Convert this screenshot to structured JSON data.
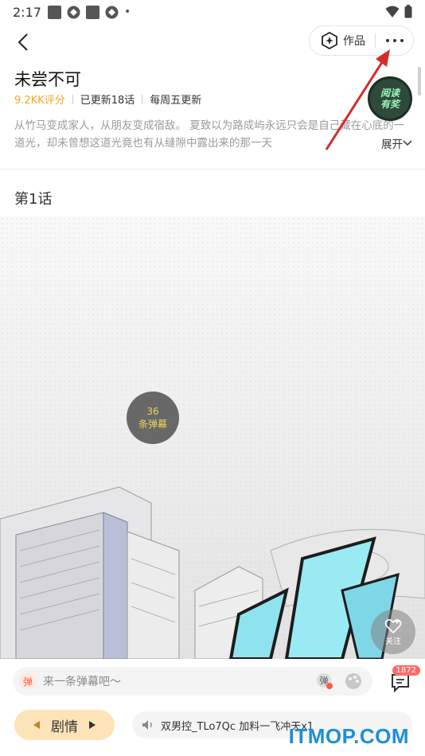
{
  "status_bar": {
    "time": "2:17",
    "dot": "•"
  },
  "nav": {
    "works_label": "作品"
  },
  "info": {
    "title": "未尝不可",
    "rating": "9.2KK评分",
    "updated": "已更新18话",
    "schedule": "每周五更新",
    "description": "从竹马变成家人，从朋友变成宿敌。 夏致以为路成屿永远只会是自己藏在心底的一道光，却未曾想这道光竟也有从缝隙中露出来的那一天",
    "expand_label": "展开",
    "badge_line1": "阅读",
    "badge_line2": "有奖"
  },
  "chapter": {
    "title": "第1话"
  },
  "comic": {
    "danmaku_count": "36",
    "danmaku_label": "条弹幕",
    "follow_label": "关注"
  },
  "bottom": {
    "dan_tag": "弹",
    "comment_placeholder": "来一条弹幕吧～",
    "comment_count": "1872",
    "plot_label": "剧情",
    "audio_text": "双男控_TLo7Qc 加料一飞冲天x1"
  },
  "watermark": "ITMOP.COM",
  "colors": {
    "accent": "#f5a623",
    "danmaku_text": "#f3d25a",
    "plot_bg": "#fde3b8",
    "watermark": "#1d8fd6",
    "arrow": "#d42b2b"
  }
}
